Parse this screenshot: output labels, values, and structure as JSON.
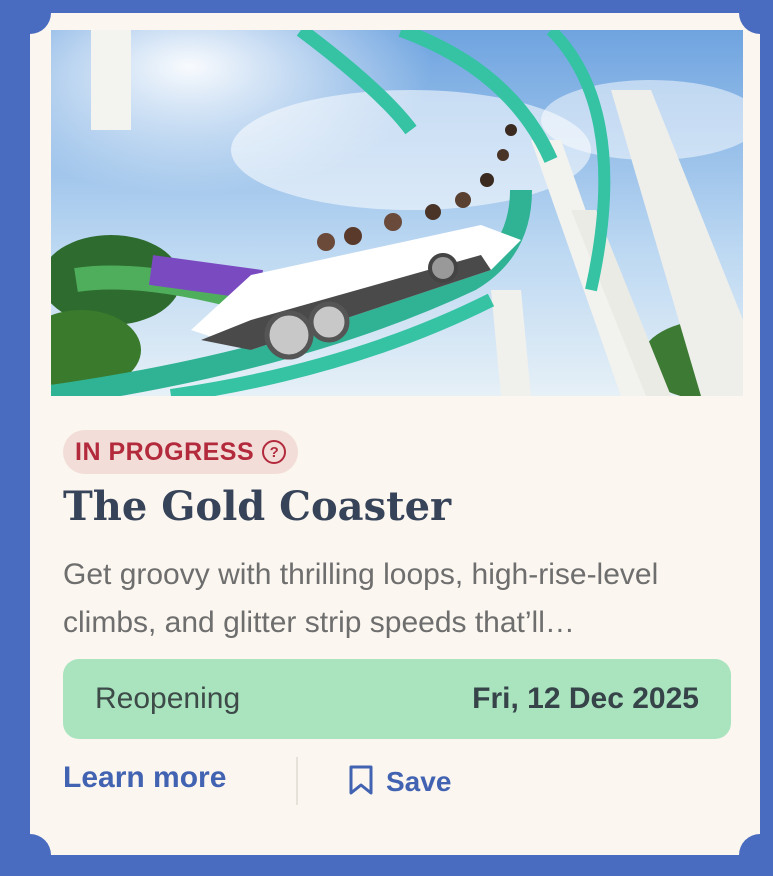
{
  "card": {
    "status": "IN PROGRESS",
    "title": "The Gold Coaster",
    "description": "Get groovy with thrilling loops, high-rise-level climbs, and glitter strip speeds that’ll…",
    "reopening_label": "Reopening",
    "reopening_date": "Fri, 12 Dec 2025",
    "learn_more": "Learn more",
    "save": "Save"
  },
  "colors": {
    "background": "#4a6cc0",
    "card": "#fbf6ef",
    "status_text": "#b22a3c",
    "status_bg": "#f3ddd8",
    "title": "#364358",
    "reopen_bg": "#a9e4bf",
    "link": "#4163b2"
  },
  "icons": {
    "status_help": "question-circle-icon",
    "save": "bookmark-icon"
  }
}
